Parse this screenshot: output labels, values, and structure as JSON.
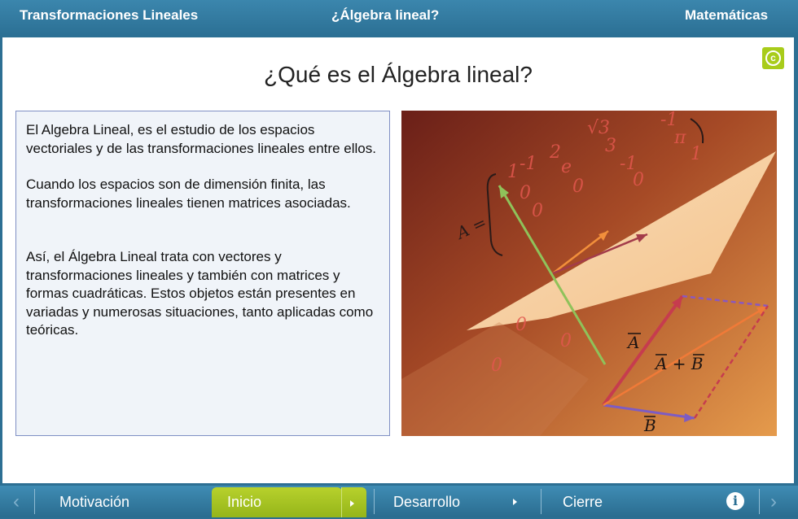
{
  "header": {
    "left_title": "Transformaciones Lineales",
    "center_title": "¿Álgebra lineal?",
    "right_title": "Matemáticas"
  },
  "main": {
    "title": "¿Qué es el Álgebra lineal?",
    "copyright_icon": "copyright-icon",
    "paragraphs": [
      "El Algebra Lineal, es el estudio de los espacios vectoriales y de las transformaciones lineales entre ellos.",
      "Cuando los espacios son de dimensión finita, las transformaciones lineales tienen matrices asociadas.",
      "Así, el Álgebra Lineal trata con vectores y transformaciones lineales y también con matrices y formas cuadráticas. Estos objetos están presentes en variadas y numerosas situaciones, tanto aplicadas como teóricas."
    ],
    "figure": {
      "matrix_label": "A =",
      "vector_a": "A",
      "vector_sum": "A + B",
      "vector_b": "B",
      "matrix_entries": [
        "√3",
        "-1",
        "π",
        "1",
        "2",
        "3",
        "-1",
        "1",
        "-1",
        "e",
        "0",
        "0",
        "0",
        "0",
        "0",
        "0",
        "0"
      ]
    }
  },
  "footer": {
    "prev_icon": "chevron-left-icon",
    "motivacion": "Motivación",
    "inicio": "Inicio",
    "desarrollo": "Desarrollo",
    "cierre": "Cierre",
    "info": "i",
    "next_icon": "chevron-right-icon"
  },
  "colors": {
    "bar": "#2b6f93",
    "active_tab": "#a6c423",
    "badge": "#a8cc1a",
    "text_border": "#7f8fc4"
  }
}
